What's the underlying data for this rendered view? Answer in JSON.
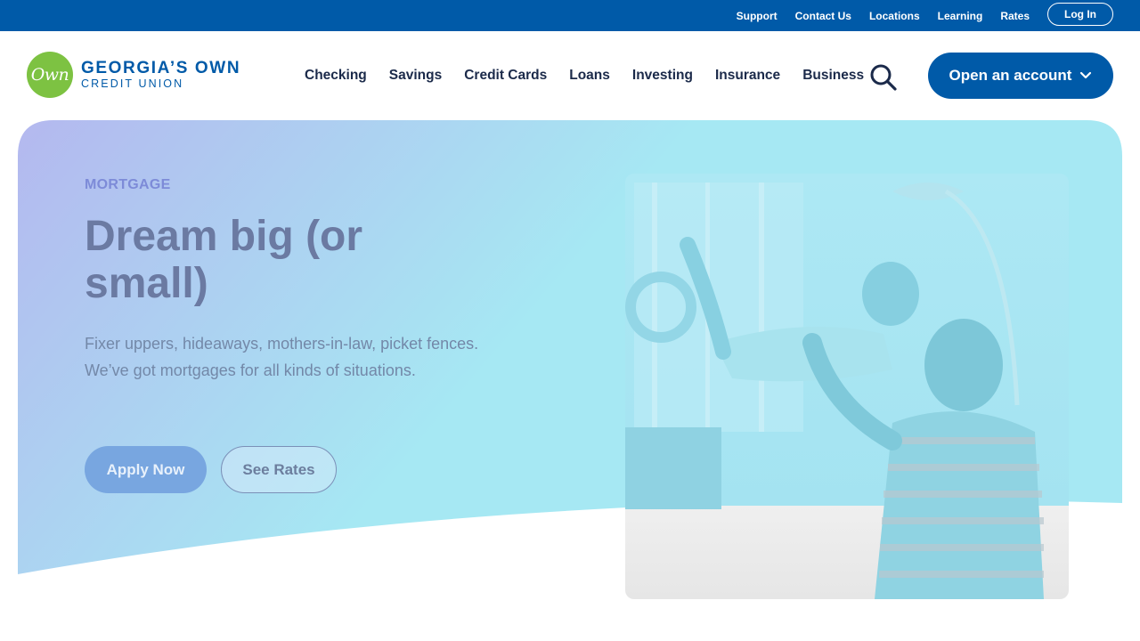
{
  "utility": {
    "links": [
      "Support",
      "Contact Us",
      "Locations",
      "Learning",
      "Rates"
    ],
    "login_label": "Log In"
  },
  "header": {
    "logo_mark": "Own",
    "logo_line1": "GEORGIA’S OWN",
    "logo_line2": "CREDIT UNION",
    "nav": [
      "Checking",
      "Savings",
      "Credit Cards",
      "Loans",
      "Investing",
      "Insurance",
      "Business"
    ],
    "open_account_label": "Open an account"
  },
  "hero": {
    "eyebrow": "MORTGAGE",
    "title": "Dream big (or small)",
    "description": "Fixer uppers, hideaways, mothers-in-law, picket fences. We’ve got mortgages for all kinds of situations.",
    "apply_label": "Apply Now",
    "rates_label": "See Rates"
  },
  "icons": {
    "search": "search-icon",
    "chevron": "chevron-down-icon",
    "photo": "family-photo"
  },
  "colors": {
    "brand_blue": "#005aa8",
    "logo_green": "#7dc242",
    "gradient_start": "#b4b8ef",
    "gradient_end": "#a6e8f3"
  }
}
